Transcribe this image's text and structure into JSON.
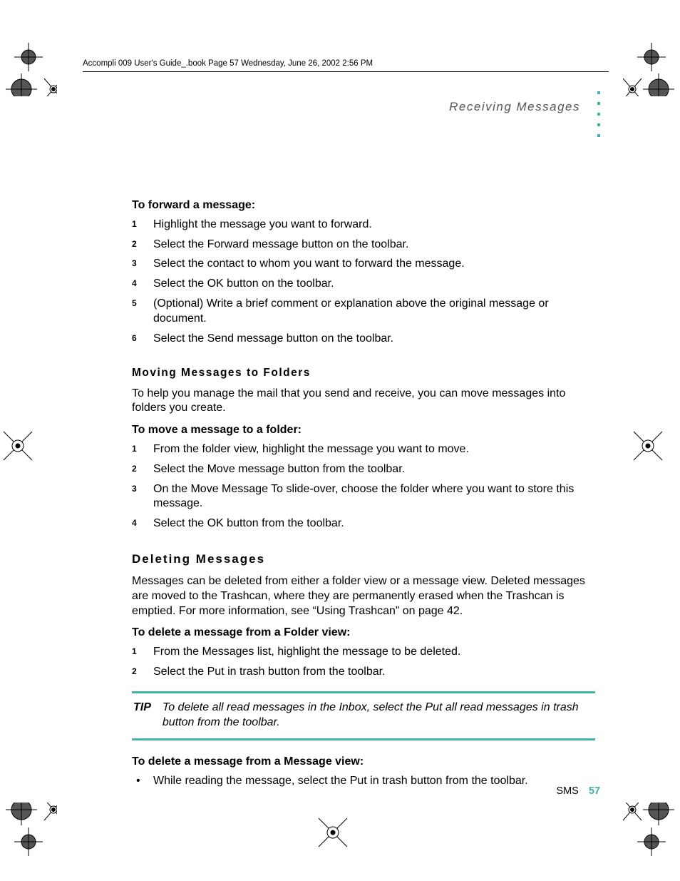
{
  "header_line": "Accompli 009 User's Guide_.book  Page 57  Wednesday, June 26, 2002  2:56 PM",
  "running_head": "Receiving Messages",
  "sections": {
    "forward": {
      "title": "To forward a message:",
      "steps": [
        "Highlight the message you want to forward.",
        "Select the Forward message button on the toolbar.",
        "Select the contact to whom you want to forward the message.",
        "Select the OK button on the toolbar.",
        "(Optional) Write a brief comment or explanation above the original message or document.",
        "Select the Send message button on the toolbar."
      ]
    },
    "moving": {
      "heading": "Moving Messages to Folders",
      "intro": "To help you manage the mail that you send and receive, you can move messages into folders you create.",
      "title": "To move a message to a folder:",
      "steps": [
        "From the folder view, highlight the message you want to move.",
        "Select the Move message button from the toolbar.",
        "On the Move Message To slide-over, choose the folder where you want to store this message.",
        "Select the OK button from the toolbar."
      ]
    },
    "deleting": {
      "heading": "Deleting Messages",
      "intro": "Messages can be deleted from either a folder view or a message view. Deleted messages are moved to the Trashcan, where they are permanently erased when the Trashcan is emptied. For more information, see “Using Trashcan” on page 42.",
      "folder_title": "To delete a message from a Folder view:",
      "folder_steps": [
        "From the Messages list, highlight the message to be deleted.",
        "Select the Put in trash button from the toolbar."
      ],
      "tip_label": "TIP",
      "tip_text": "To delete all read messages in the Inbox, select the Put all read messages in trash button from the toolbar.",
      "msg_title": "To delete a message from a Message view:",
      "msg_bullets": [
        "While reading the message, select the Put in trash button from the toolbar."
      ]
    }
  },
  "footer": {
    "label": "SMS",
    "page": "57"
  }
}
